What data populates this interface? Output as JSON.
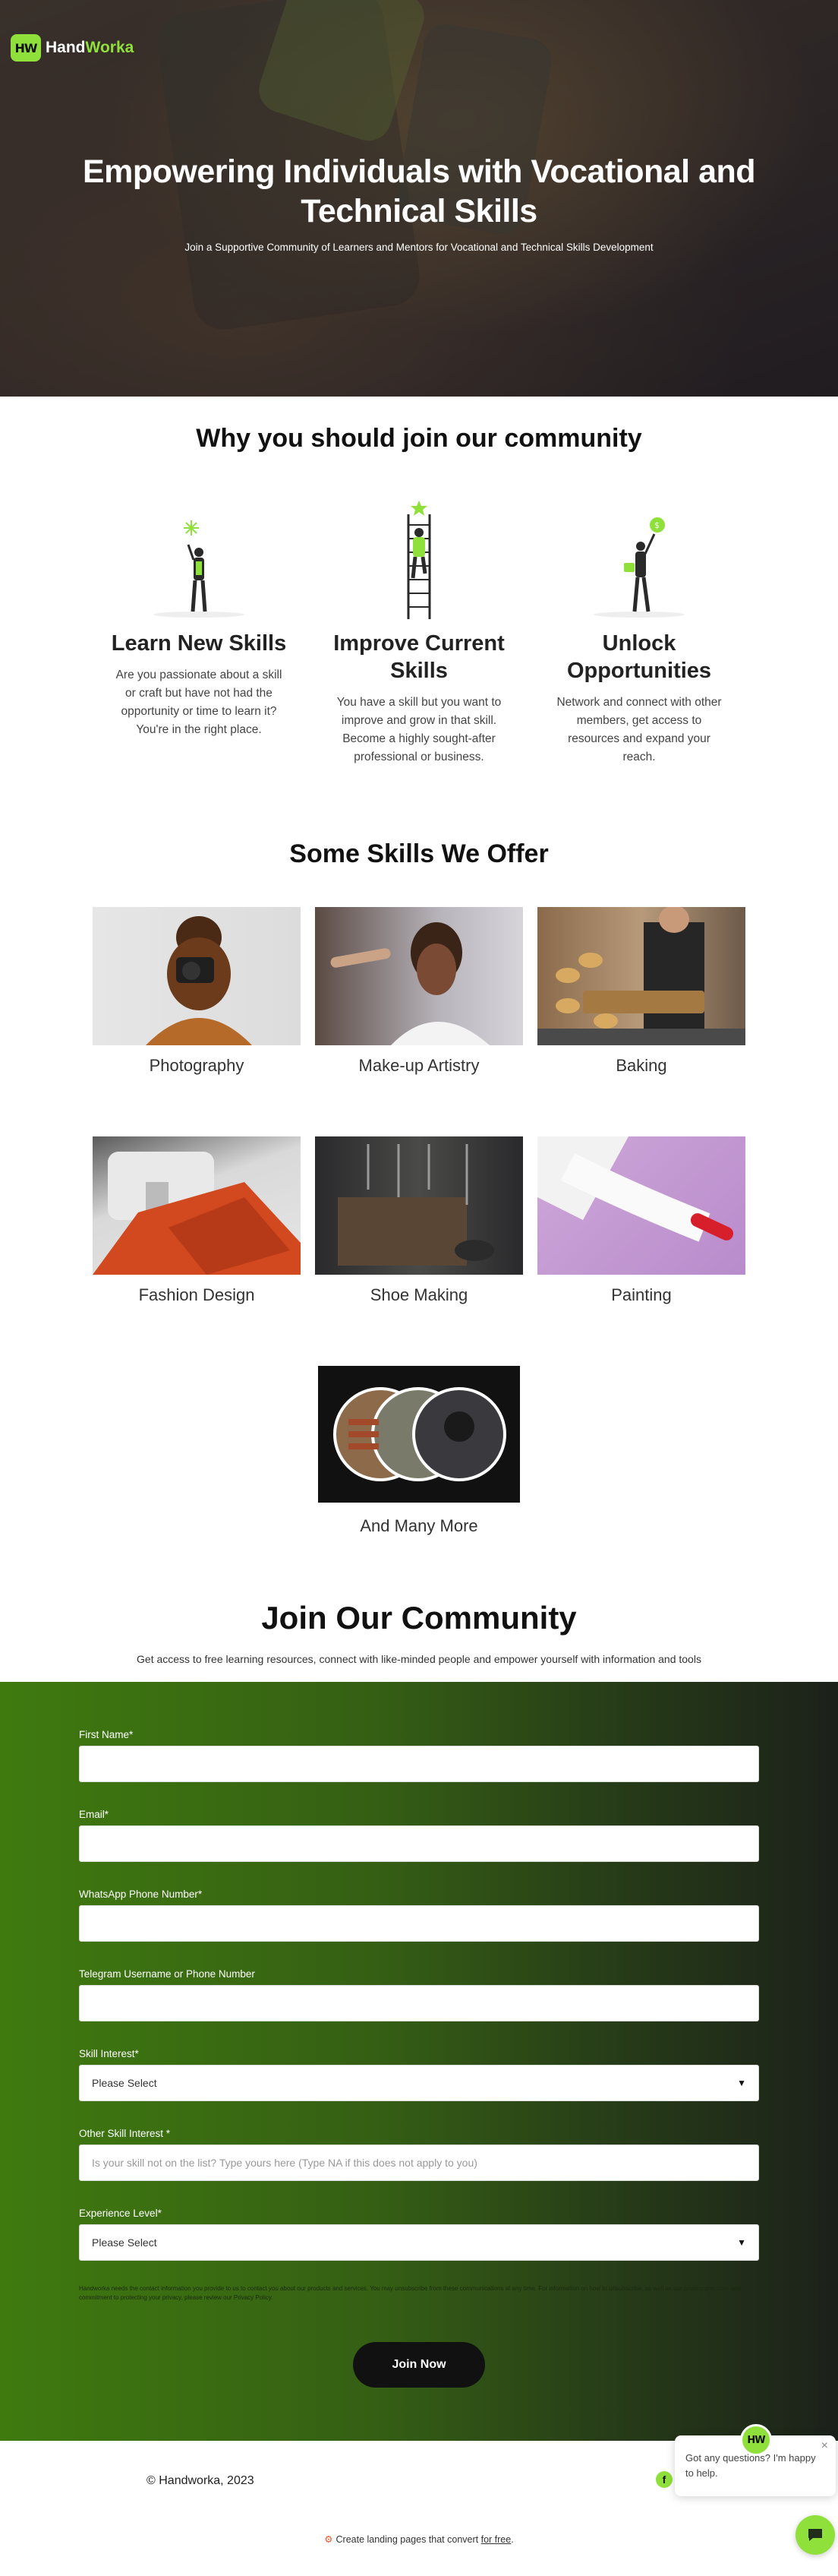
{
  "brand": {
    "logo_mark": "HW",
    "name_part1": "Hand",
    "name_part2": "Worka"
  },
  "hero": {
    "title": "Empowering Individuals with Vocational and Technical Skills",
    "subtitle": "Join a Supportive Community of Learners and Mentors for Vocational and Technical Skills Development"
  },
  "why": {
    "title": "Why you should join our community",
    "features": [
      {
        "title": "Learn New Skills",
        "text": "Are you passionate about a skill or craft but have not had the opportunity or time to learn it? You're in the right place."
      },
      {
        "title": "Improve Current Skills",
        "text": "You have a skill but you want to improve and grow in that skill. Become a highly sought-after professional or business."
      },
      {
        "title": "Unlock Opportunities",
        "text": "Network and connect with other members, get access to resources and expand your reach."
      }
    ]
  },
  "skills": {
    "title": "Some Skills We Offer",
    "items": [
      {
        "label": "Photography"
      },
      {
        "label": "Make-up Artistry"
      },
      {
        "label": "Baking"
      },
      {
        "label": "Fashion Design"
      },
      {
        "label": "Shoe Making"
      },
      {
        "label": "Painting"
      }
    ],
    "more_label": "And Many More"
  },
  "join": {
    "title": "Join Our Community",
    "subtitle": "Get access to free learning resources, connect with like-minded people and empower yourself with information and tools"
  },
  "form": {
    "first_name_label": "First Name*",
    "email_label": "Email*",
    "whatsapp_label": "WhatsApp Phone Number*",
    "telegram_label": "Telegram Username or Phone Number",
    "skill_interest_label": "Skill Interest*",
    "skill_interest_value": "Please Select",
    "other_skill_label": "Other Skill Interest *",
    "other_skill_placeholder": "Is your skill not on the list? Type yours here (Type NA if this does not apply to you)",
    "experience_label": "Experience Level*",
    "experience_value": "Please Select",
    "disclaimer": "Handworka needs the contact information you provide to us to contact you about our products and services. You may unsubscribe from these communications at any time. For information on how to unsubscribe, as well as our privacy practices and commitment to protecting your privacy, please review our Privacy Policy.",
    "submit_label": "Join Now"
  },
  "footer": {
    "copyright": "© Handworka, 2023",
    "fb_icon": "f",
    "chat_message": "Got any questions? I'm happy to help.",
    "chat_close": "×",
    "hubspot_text": "Create landing pages that convert ",
    "hubspot_link": "for free",
    "hubspot_suffix": "."
  },
  "colors": {
    "accent": "#8fe03b",
    "form_bg_start": "#3f7a0f",
    "form_bg_end": "#1c211a",
    "button": "#111111"
  }
}
